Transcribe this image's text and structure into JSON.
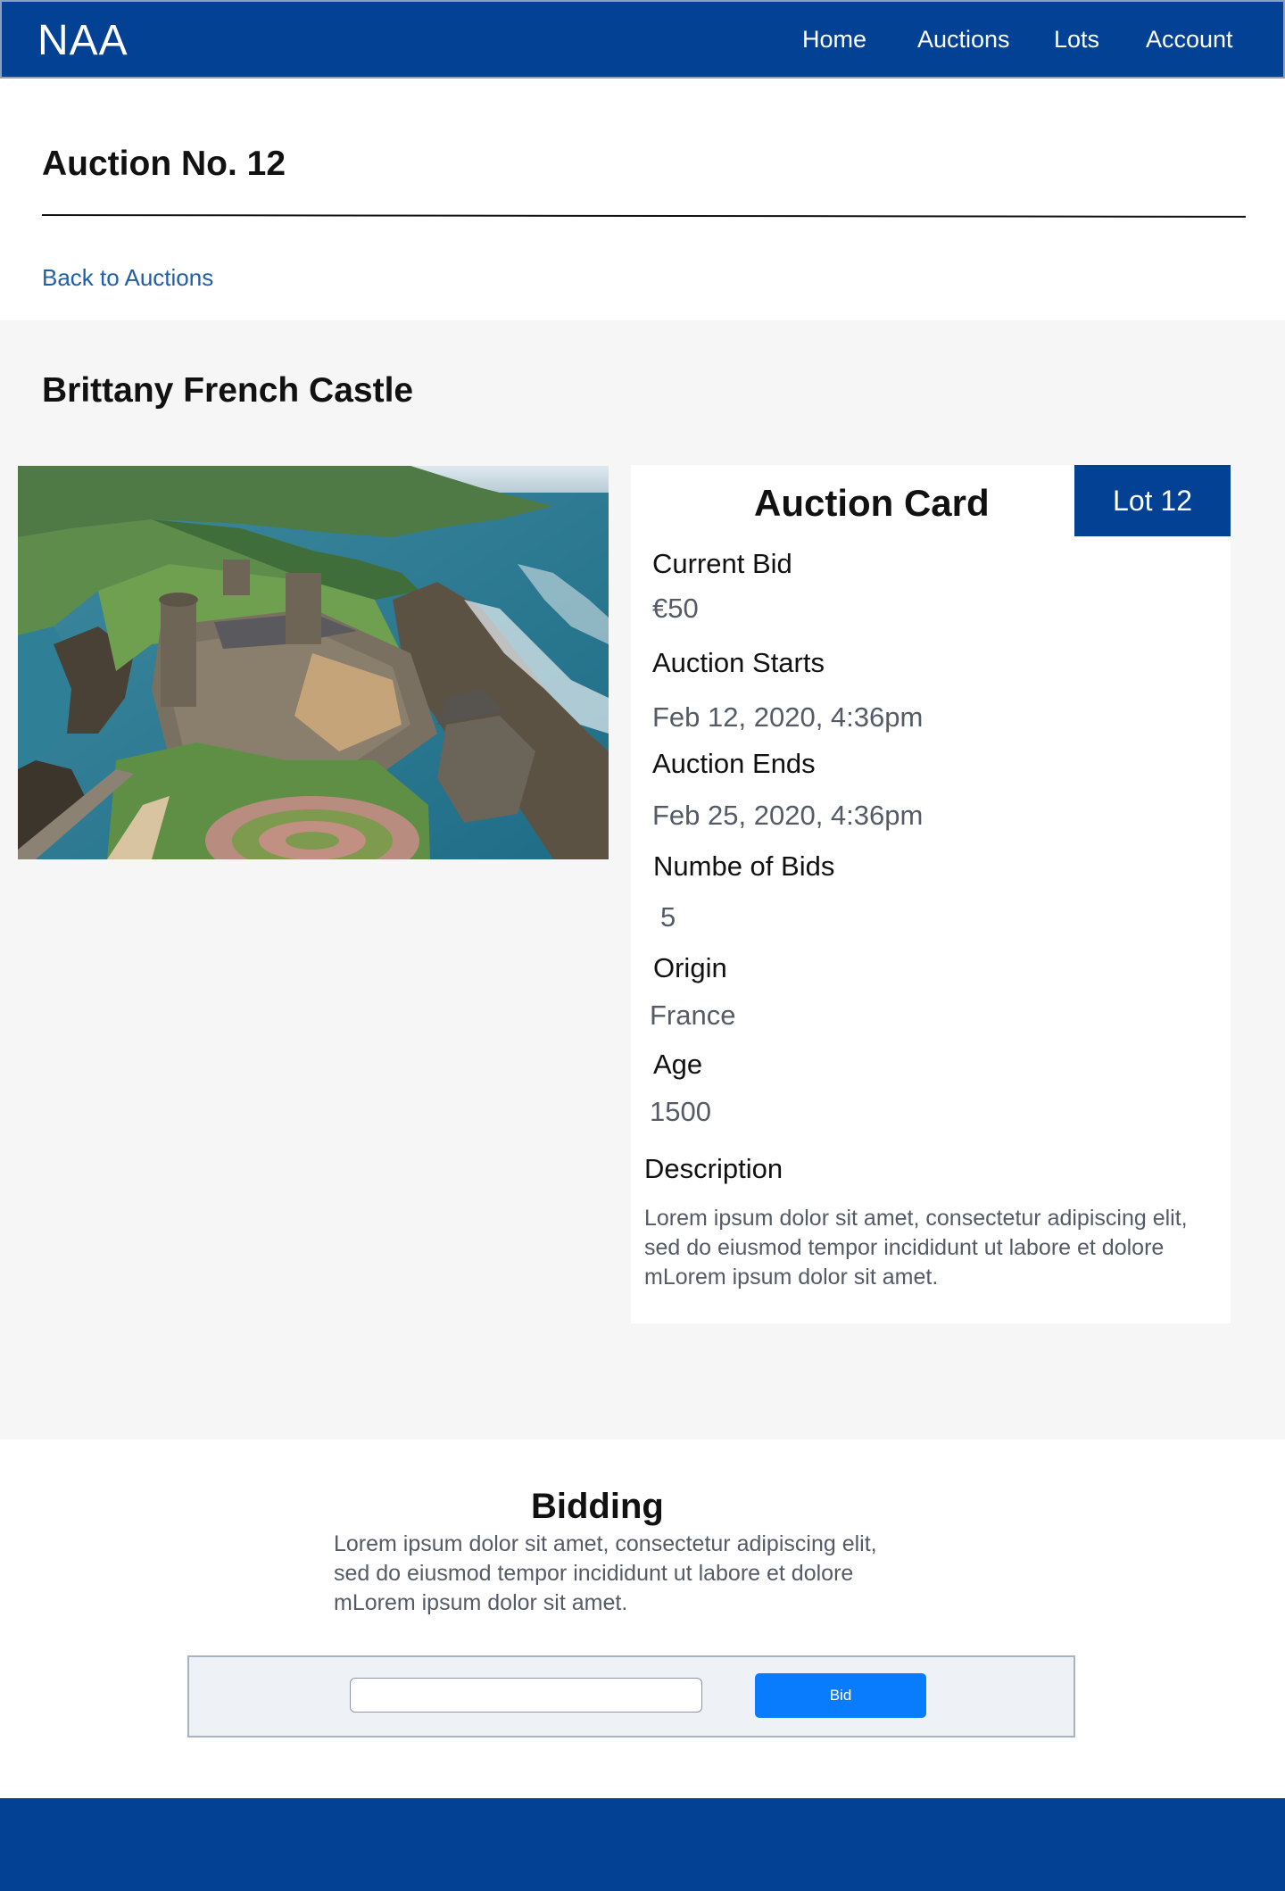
{
  "nav": {
    "brand": "NAA",
    "links": [
      "Home",
      "Auctions",
      "Lots",
      "Account"
    ]
  },
  "page": {
    "title": "Auction No. 12",
    "back_link": "Back to  Auctions"
  },
  "lot": {
    "title": "Brittany French Castle",
    "photo_icon": "castle-photo"
  },
  "card": {
    "title": "Auction Card",
    "badge": "Lot 12",
    "current_bid_label": "Current Bid",
    "current_bid_value": "€50",
    "starts_label": "Auction Starts",
    "starts_value": "Feb 12, 2020, 4:36pm",
    "ends_label": "Auction Ends",
    "ends_value": "Feb 25, 2020, 4:36pm",
    "bids_label": "Numbe of  Bids",
    "bids_value": "5",
    "origin_label": "Origin",
    "origin_value": "France",
    "age_label": "Age",
    "age_value": "1500",
    "description_label": "Description",
    "description_text": "Lorem ipsum dolor sit amet, consectetur adipiscing elit, sed do eiusmod tempor incididunt ut labore et dolore mLorem ipsum dolor sit amet."
  },
  "bidding": {
    "title": "Bidding",
    "text": "Lorem ipsum dolor sit amet, consectetur adipiscing elit, sed do eiusmod tempor incididunt ut labore et dolore mLorem ipsum dolor sit amet.",
    "input_value": "",
    "button_label": "Bid"
  },
  "colors": {
    "brand_blue": "#034194",
    "link_blue": "#1f5fa8",
    "button_blue": "#097cfd",
    "section_gray": "#f6f6f6"
  }
}
